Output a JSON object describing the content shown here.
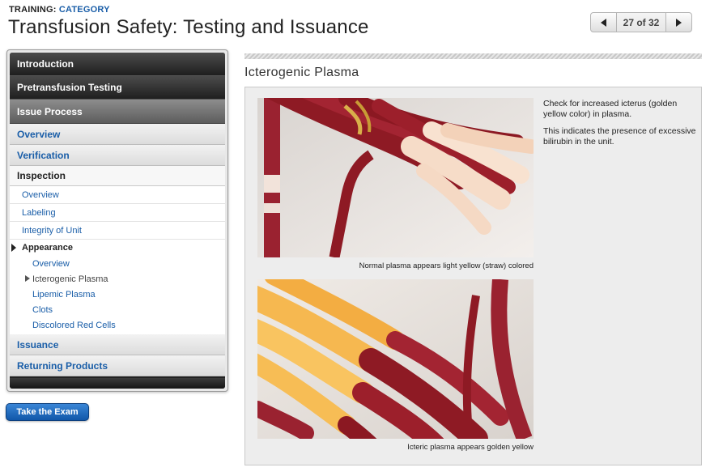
{
  "header": {
    "training_label": "TRAINING:",
    "category_label": "CATEGORY",
    "title": "Transfusion Safety: Testing and Issuance"
  },
  "pager": {
    "position": "27 of 32",
    "prev_icon": "triangle-left-icon",
    "next_icon": "triangle-right-icon"
  },
  "sidebar": {
    "sections": {
      "introduction": "Introduction",
      "pretransfusion": "Pretransfusion Testing",
      "issue_process": "Issue Process"
    },
    "issue_process_items": {
      "overview": "Overview",
      "verification": "Verification",
      "inspection": "Inspection"
    },
    "inspection_items": {
      "overview": "Overview",
      "labeling": "Labeling",
      "integrity": "Integrity of Unit",
      "appearance": "Appearance"
    },
    "appearance_items": {
      "overview": "Overview",
      "icterogenic": "Icterogenic Plasma",
      "lipemic": "Lipemic Plasma",
      "clots": "Clots",
      "discolored": "Discolored Red Cells"
    },
    "issuance": "Issuance",
    "returning": "Returning Products"
  },
  "exam_button": "Take the Exam",
  "main": {
    "section_title": "Icterogenic Plasma",
    "description_1": "Check for increased icterus (golden yellow color) in plasma.",
    "description_2": "This indicates the presence of excessive bilirubin in the unit.",
    "caption_1": "Normal plasma appears light yellow (straw) colored",
    "caption_2": "Icteric plasma appears golden yellow"
  },
  "colors": {
    "link_blue": "#1a5ea8",
    "exam_button": "#1f6cc0",
    "tube_red": "#8e1a24",
    "normal_plasma": "#f7d8c0",
    "icteric_plasma": "#f7b54a"
  }
}
